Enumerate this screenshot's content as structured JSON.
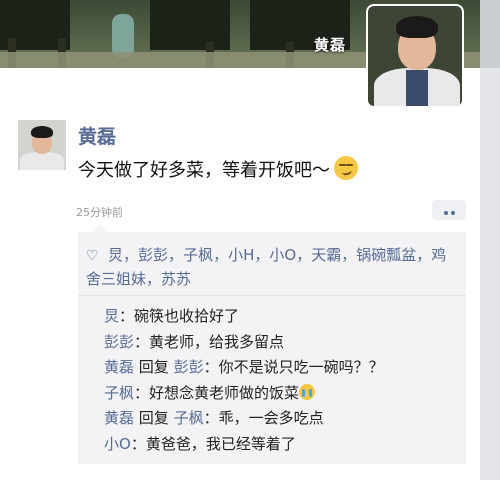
{
  "profile": {
    "cover_name": "黄磊"
  },
  "post": {
    "author": "黄磊",
    "text": "今天做了好多菜，等着开饭吧～",
    "text_emoji": "smirk-emoji",
    "time": "25分钟前",
    "more_icon": "more-dots-icon"
  },
  "likes": {
    "icon": "heart-outline-icon",
    "names": [
      "炅",
      "彭彭",
      "子枫",
      "小H",
      "小O",
      "天霸",
      "锅碗瓢盆",
      "鸡舍三姐妹",
      "苏苏"
    ],
    "separator": "，"
  },
  "comments": [
    {
      "author": "炅",
      "reply_word": "",
      "reply_to": "",
      "text": "碗筷也收拾好了",
      "emoji": ""
    },
    {
      "author": "彭彭",
      "reply_word": "",
      "reply_to": "",
      "text": "黄老师，给我多留点",
      "emoji": ""
    },
    {
      "author": "黄磊",
      "reply_word": "回复",
      "reply_to": "彭彭",
      "text": "你不是说只吃一碗吗？？",
      "emoji": ""
    },
    {
      "author": "子枫",
      "reply_word": "",
      "reply_to": "",
      "text": "好想念黄老师做的饭菜",
      "emoji": "crying-emoji"
    },
    {
      "author": "黄磊",
      "reply_word": "回复",
      "reply_to": "子枫",
      "text": "乖，一会多吃点",
      "emoji": ""
    },
    {
      "author": "小O",
      "reply_word": "",
      "reply_to": "",
      "text": "黄爸爸，我已经等着了",
      "emoji": ""
    }
  ],
  "colors": {
    "link": "#576b95",
    "panel": "#f3f3f5",
    "text": "#111111",
    "muted": "#9a9a9a"
  }
}
